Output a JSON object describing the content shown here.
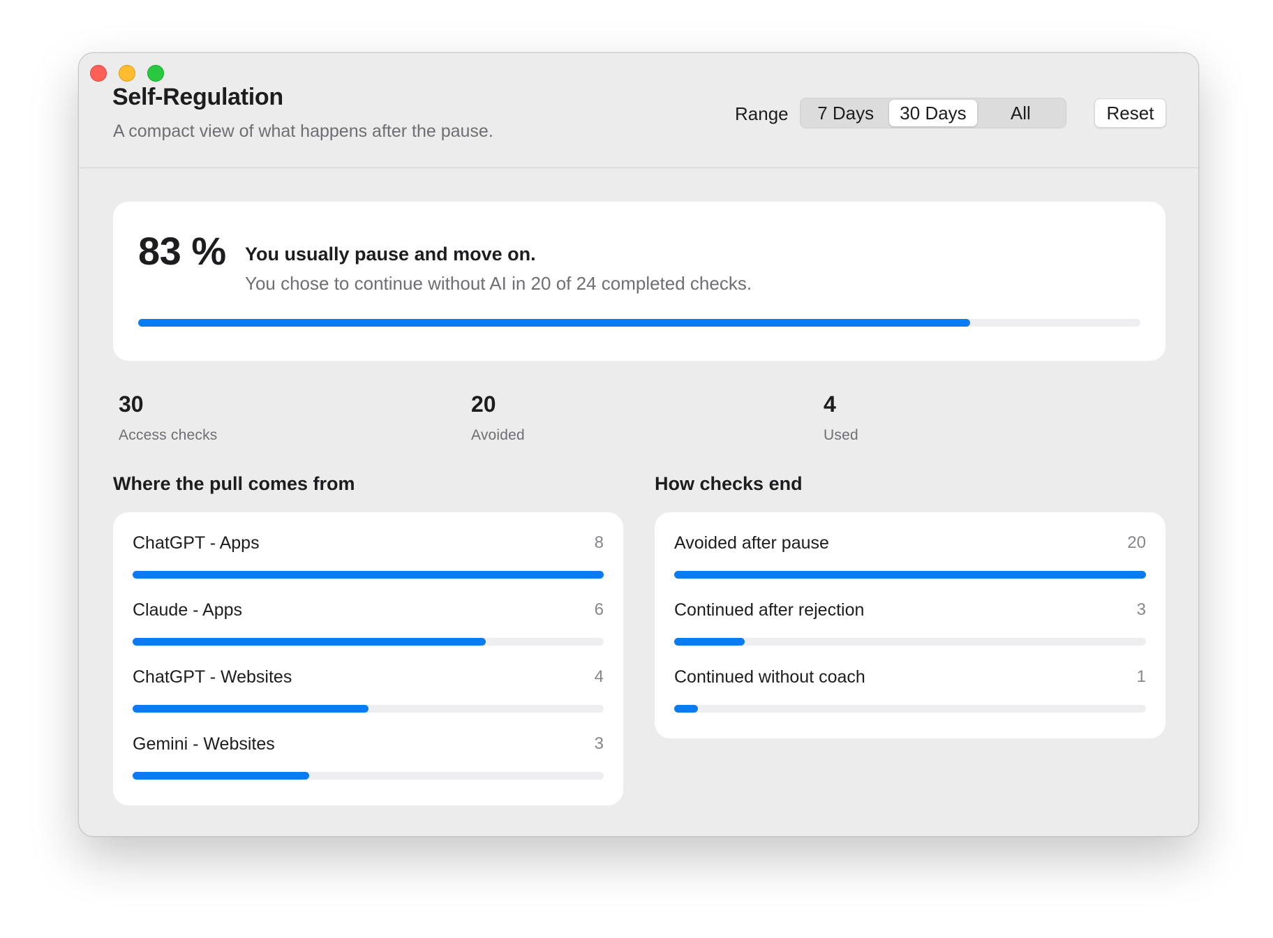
{
  "window": {
    "title": "Self-Regulation",
    "subtitle": "A compact view of what happens after the pause."
  },
  "range": {
    "label": "Range",
    "options": [
      "7 Days",
      "30 Days",
      "All"
    ],
    "selected": "30 Days"
  },
  "reset_label": "Reset",
  "summary": {
    "percent_text": "83 %",
    "headline": "You usually pause and move on.",
    "detail": "You chose to continue without AI in 20 of 24 completed checks.",
    "progress": 0.83
  },
  "stats": [
    {
      "value": "30",
      "label": "Access checks"
    },
    {
      "value": "20",
      "label": "Avoided"
    },
    {
      "value": "4",
      "label": "Used"
    }
  ],
  "pull_sources": {
    "title": "Where the pull comes from",
    "max": 8,
    "items": [
      {
        "label": "ChatGPT - Apps",
        "count": 8
      },
      {
        "label": "Claude - Apps",
        "count": 6
      },
      {
        "label": "ChatGPT - Websites",
        "count": 4
      },
      {
        "label": "Gemini - Websites",
        "count": 3
      }
    ]
  },
  "check_outcomes": {
    "title": "How checks end",
    "max": 20,
    "items": [
      {
        "label": "Avoided after pause",
        "count": 20
      },
      {
        "label": "Continued after rejection",
        "count": 3
      },
      {
        "label": "Continued without coach",
        "count": 1
      }
    ]
  },
  "colors": {
    "accent": "#0a7cf0",
    "track": "#eeeef0",
    "window_bg": "#ececec",
    "card_bg": "#ffffff"
  }
}
